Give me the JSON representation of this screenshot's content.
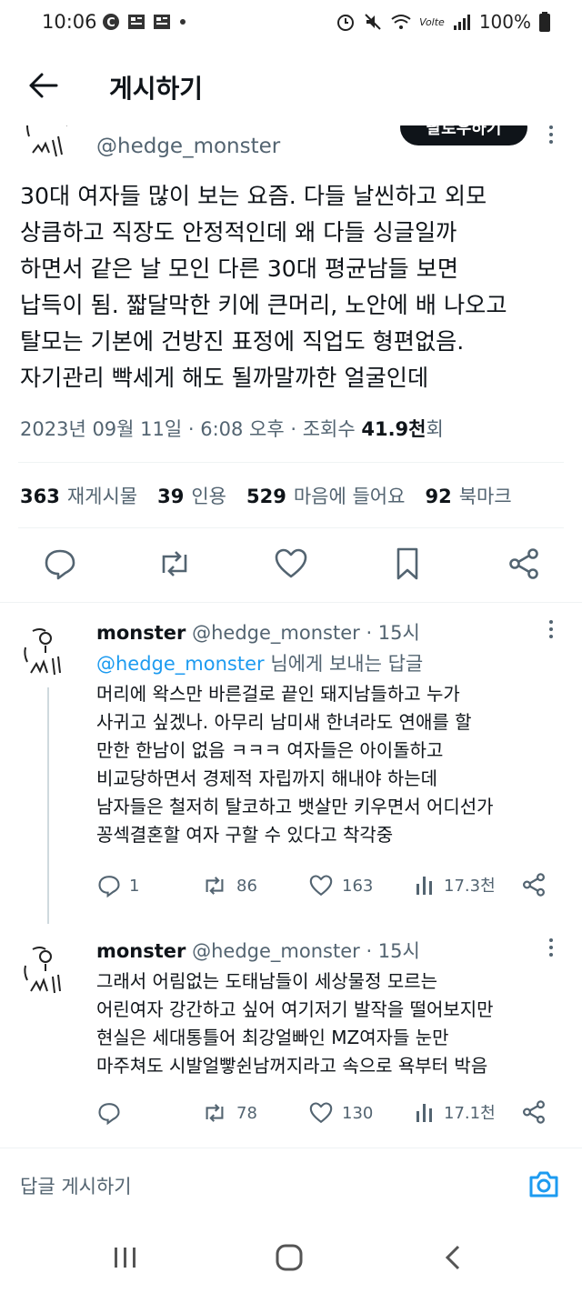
{
  "status_bar": {
    "time": "10:06",
    "network": "Volte",
    "battery": "100%"
  },
  "header": {
    "title": "게시하기"
  },
  "main_tweet": {
    "handle": "@hedge_monster",
    "follow_label": "팔로우하기",
    "text_lines": [
      "30대 여자들 많이 보는 요즘. 다들 날씬하고 외모",
      "상큼하고 직장도 안정적인데 왜 다들 싱글일까",
      "하면서 같은 날 모인 다른 30대 평균남들 보면",
      "납득이 됨. 짧달막한 키에 큰머리, 노안에 배 나오고",
      "탈모는 기본에 건방진 표정에 직업도 형편없음.",
      "자기관리 빡세게 해도 될까말까한 얼굴인데"
    ],
    "timestamp": "2023년 09월 11일 · 6:08 오후 · 조회수 ",
    "views": "41.9천",
    "views_suffix": "회",
    "stats": {
      "reposts_count": "363",
      "reposts_label": "재게시물",
      "quotes_count": "39",
      "quotes_label": "인용",
      "likes_count": "529",
      "likes_label": "마음에 들어요",
      "bookmarks_count": "92",
      "bookmarks_label": "북마크"
    }
  },
  "replies": [
    {
      "name": "monster",
      "handle": "@hedge_monster",
      "time": "· 15시",
      "reply_to_mention": "@hedge_monster",
      "reply_to_suffix": " 님에게 보내는 답글",
      "text_lines": [
        "머리에 왁스만 바른걸로 끝인 돼지남들하고 누가",
        "사귀고 싶겠나. 아무리 남미새 한녀라도 연애를 할",
        "만한 한남이 없음 ㅋㅋㅋ 여자들은 아이돌하고",
        "비교당하면서 경제적 자립까지 해내야 하는데",
        "남자들은 철저히 탈코하고 뱃살만 키우면서 어디선가",
        "꽁섹결혼할 여자 구할 수 있다고 착각중"
      ],
      "replies": "1",
      "reposts": "86",
      "likes": "163",
      "views": "17.3천"
    },
    {
      "name": "monster",
      "handle": "@hedge_monster",
      "time": "· 15시",
      "text_lines": [
        "그래서 어림없는 도태남들이 세상물정 모르는",
        "어린여자 강간하고 싶어 여기저기 발작을 떨어보지만",
        "현실은 세대통틀어 최강얼빠인 MZ여자들 눈만",
        "마주쳐도 시발얼빻쉰남꺼지라고 속으로 욕부터 박음"
      ],
      "replies": "",
      "reposts": "78",
      "likes": "130",
      "views": "17.1천"
    }
  ],
  "reply_bar": {
    "placeholder": "답글 게시하기"
  },
  "colors": {
    "accent": "#1d9bf0",
    "text": "#0f1419",
    "muted": "#536471",
    "divider": "#eff3f4"
  }
}
